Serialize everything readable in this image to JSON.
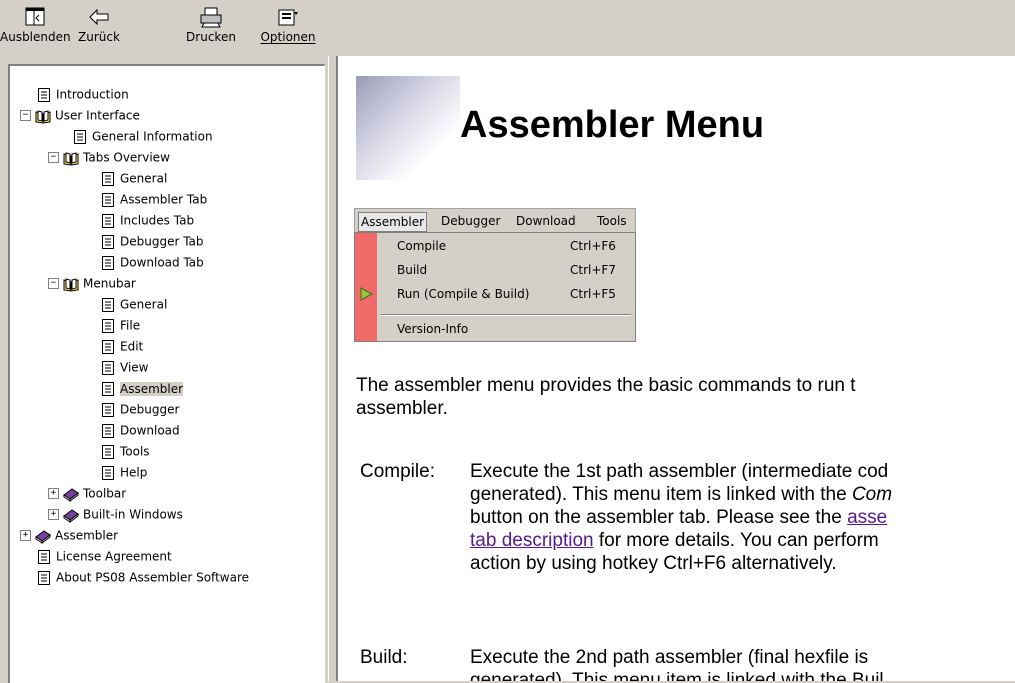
{
  "toolbar": {
    "hide_label": "Ausblenden",
    "back_label": "Zurück",
    "print_label": "Drucken",
    "options_label": "Optionen"
  },
  "tree": {
    "introduction": "Introduction",
    "user_interface": "User Interface",
    "general_information": "General Information",
    "tabs_overview": "Tabs Overview",
    "tabs_general": "General",
    "assembler_tab": "Assembler Tab",
    "includes_tab": "Includes Tab",
    "debugger_tab": "Debugger Tab",
    "download_tab": "Download Tab",
    "menubar": "Menubar",
    "menubar_general": "General",
    "file": "File",
    "edit": "Edit",
    "view": "View",
    "assembler": "Assembler",
    "debugger": "Debugger",
    "download": "Download",
    "tools": "Tools",
    "help": "Help",
    "toolbar": "Toolbar",
    "builtin_windows": "Built-in Windows",
    "assembler_book": "Assembler",
    "license": "License Agreement",
    "about": "About PS08 Assembler Software"
  },
  "content": {
    "title": "Assembler Menu",
    "menu_shot": {
      "bar": [
        "Assembler",
        "Debugger",
        "Download",
        "Tools"
      ],
      "items": [
        {
          "label": "Compile",
          "key": "Ctrl+F6"
        },
        {
          "label": "Build",
          "key": "Ctrl+F7"
        },
        {
          "label": "Run (Compile & Build)",
          "key": "Ctrl+F5"
        },
        {
          "label": "Version-Info",
          "key": ""
        }
      ]
    },
    "intro_line1": "The assembler menu provides the basic commands to run t",
    "intro_line2": "assembler.",
    "compile_term": "Compile:",
    "compile_l1": "Execute the 1st path assembler (intermediate cod",
    "compile_l2a": "generated). This menu item is linked with the ",
    "compile_l2b": "Com",
    "compile_l3a": "button on the assembler tab. Please see the ",
    "compile_l3b": "asse",
    "compile_l4a": "tab description",
    "compile_l4b": " for more details. You can perform",
    "compile_l5": "action by using hotkey Ctrl+F6 alternatively.",
    "build_term": "Build:",
    "build_l1": "Execute the 2nd path assembler (final hexfile is",
    "build_l2": "generated). This menu item is linked with the Buil"
  },
  "colors": {
    "chrome": "#d4d0c8",
    "menu_strip": "#f06a6a",
    "link": "#551a8b"
  },
  "icons": [
    "hide-icon",
    "back-arrow-icon",
    "printer-icon",
    "options-icon",
    "page-icon",
    "open-book-icon",
    "closed-book-icon",
    "play-icon"
  ]
}
